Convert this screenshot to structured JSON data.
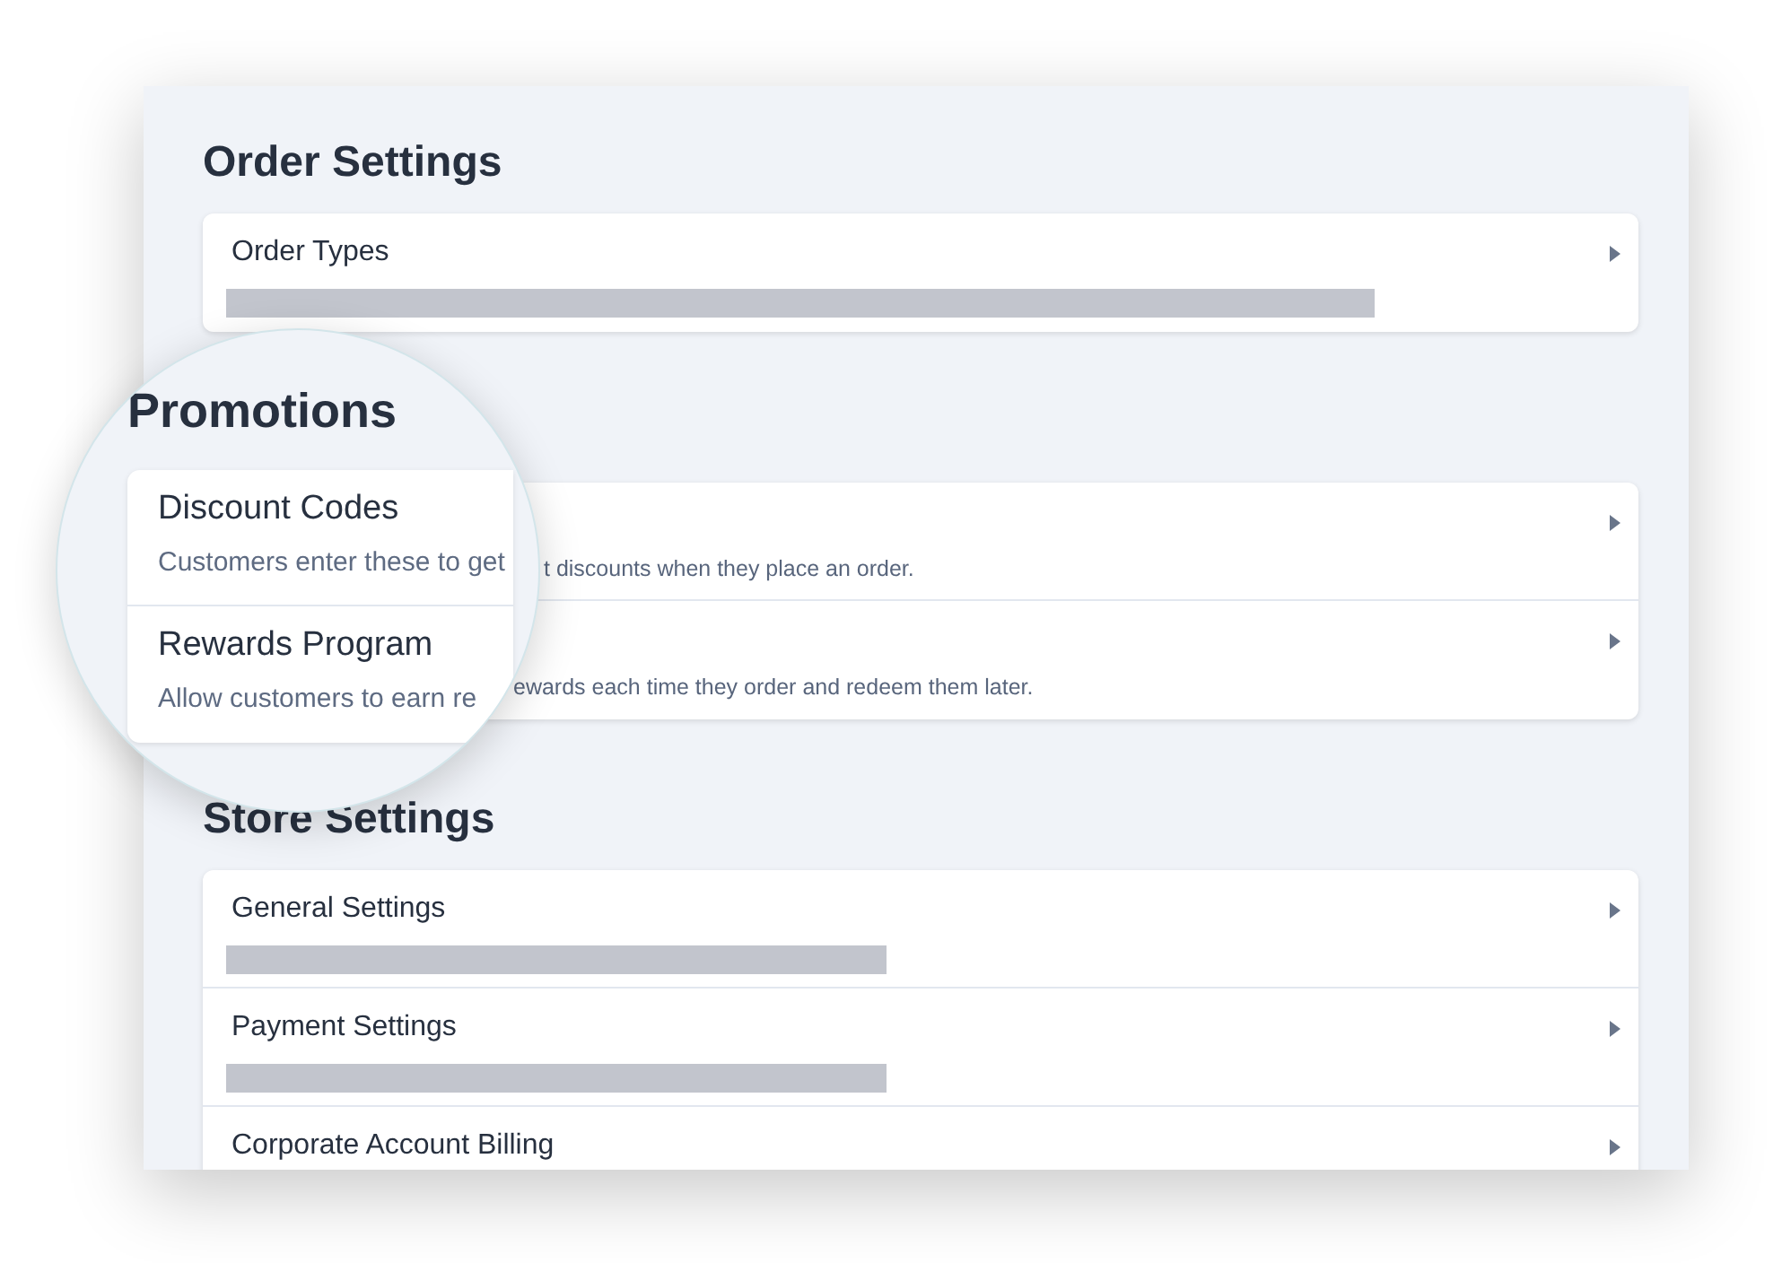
{
  "sections": [
    {
      "heading": "Order Settings",
      "magnified": false,
      "rows": [
        {
          "title": "Order Types",
          "redacted": true
        }
      ]
    },
    {
      "heading": "Promotions",
      "magnified": true,
      "rows": [
        {
          "title": "Discount Codes",
          "description": "Customers enter these to get",
          "behind_text": "t discounts when they place an order."
        },
        {
          "title": "Rewards Program",
          "description": "Allow customers to earn re",
          "behind_text": "ewards each time they order and redeem them later."
        }
      ]
    },
    {
      "heading": "Store Settings",
      "magnified": false,
      "rows": [
        {
          "title": "General Settings",
          "redacted": true
        },
        {
          "title": "Payment Settings",
          "redacted": true
        },
        {
          "title": "Corporate Account Billing"
        }
      ]
    }
  ]
}
